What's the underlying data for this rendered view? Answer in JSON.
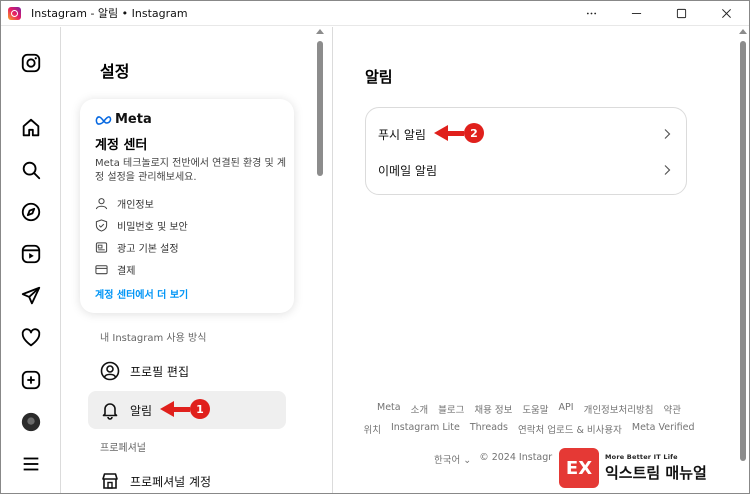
{
  "window": {
    "title": "Instagram - 알림 • Instagram"
  },
  "settings": {
    "title": "설정",
    "meta_card": {
      "brand": "Meta",
      "title": "계정 센터",
      "description": "Meta 테크놀로지 전반에서 연결된 환경 및 계정 설정을 관리해보세요.",
      "items": [
        {
          "label": "개인정보",
          "icon": "person-icon"
        },
        {
          "label": "비밀번호 및 보안",
          "icon": "shield-icon"
        },
        {
          "label": "광고 기본 설정",
          "icon": "ad-icon"
        },
        {
          "label": "결제",
          "icon": "card-icon"
        }
      ],
      "link": "계정 센터에서 더 보기"
    },
    "section_how": "내 Instagram 사용 방식",
    "menu": [
      {
        "label": "프로필 편집",
        "icon": "profile-icon"
      },
      {
        "label": "알림",
        "icon": "bell-icon"
      }
    ],
    "section_pro": "프로페셔널",
    "pro_menu": [
      {
        "label": "프로페셔널 계정",
        "icon": "shop-icon"
      }
    ]
  },
  "main": {
    "title": "알림",
    "rows": [
      {
        "label": "푸시 알림"
      },
      {
        "label": "이메일 알림"
      }
    ]
  },
  "footer": {
    "row1": [
      "Meta",
      "소개",
      "블로그",
      "채용 정보",
      "도움말",
      "API",
      "개인정보처리방침",
      "약관"
    ],
    "row2": [
      "위치",
      "Instagram Lite",
      "Threads",
      "연락처 업로드 & 비사용자",
      "Meta Verified"
    ],
    "language": "한국어 ⌄",
    "copyright": "© 2024 Instagr"
  },
  "callouts": {
    "one": "1",
    "two": "2"
  },
  "watermark": {
    "badge": "EX",
    "sub": "More Better IT Life",
    "main": "익스트림 매뉴얼"
  },
  "colors": {
    "accent_link": "#0095f6",
    "callout": "#e0201c",
    "active_bg": "#efefef"
  }
}
